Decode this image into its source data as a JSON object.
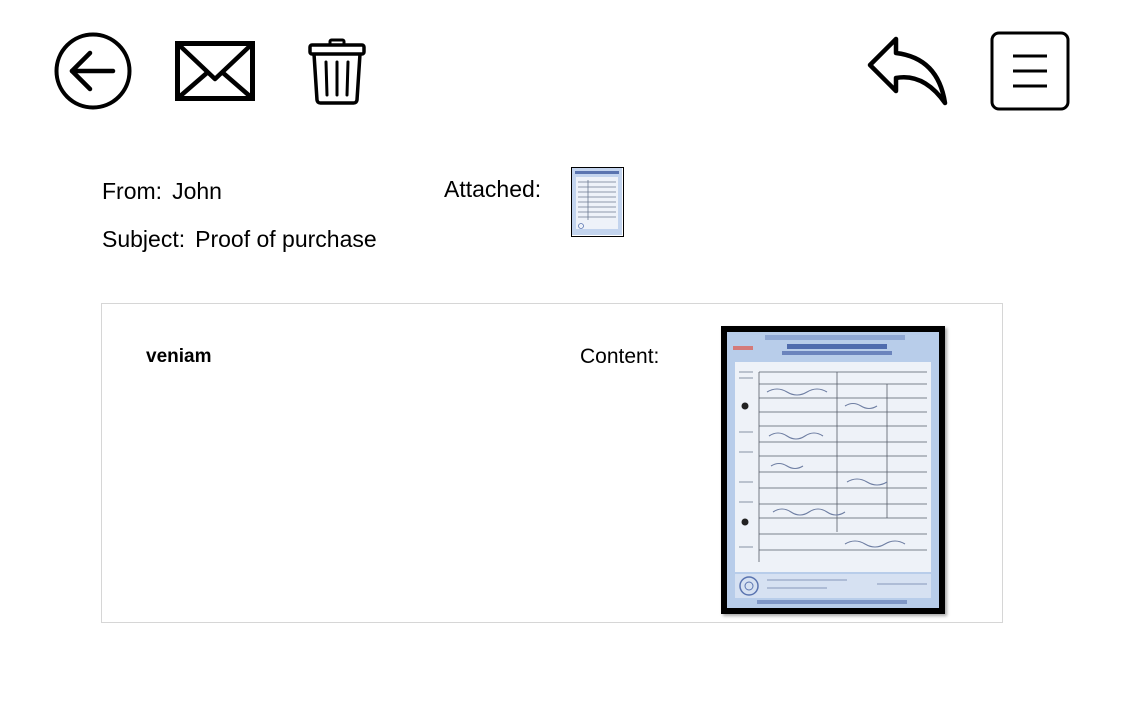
{
  "toolbar": {
    "back_icon": "back-arrow-circle-icon",
    "mail_icon": "envelope-icon",
    "trash_icon": "trash-icon",
    "reply_icon": "reply-arrow-icon",
    "menu_icon": "hamburger-menu-icon"
  },
  "message": {
    "from_label": "From:",
    "from_value": "John",
    "subject_label": "Subject:",
    "subject_value": "Proof of purchase",
    "attached_label": "Attached:",
    "attachment_icon": "document-thumbnail-icon"
  },
  "content": {
    "body_text": "veniam",
    "content_label": "Content:",
    "document_image": "certificate-document-image"
  },
  "colors": {
    "panel_border": "#d6d6d6",
    "document_blue": "#b8cdea"
  }
}
